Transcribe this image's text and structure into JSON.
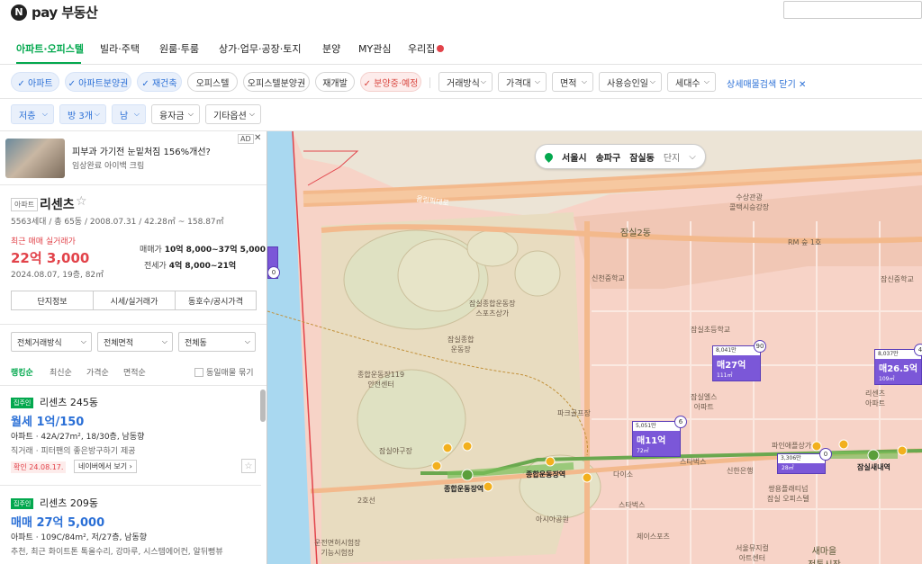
{
  "brand": {
    "logo_letter": "N",
    "name": "pay 부동산"
  },
  "nav": {
    "items": [
      {
        "label": "아파트·오피스텔",
        "active": true
      },
      {
        "label": "빌라·주택"
      },
      {
        "label": "원룸·투룸"
      },
      {
        "label": "상가·업무·공장·토지"
      },
      {
        "label": "분양"
      },
      {
        "label": "MY관심"
      },
      {
        "label": "우리집"
      }
    ]
  },
  "filters": {
    "chips": [
      {
        "label": "✓ 아파트",
        "style": "sel"
      },
      {
        "label": "✓ 아파트분양권",
        "style": "sel"
      },
      {
        "label": "✓ 재건축",
        "style": "sel"
      },
      {
        "label": "오피스텔",
        "style": "plain"
      },
      {
        "label": "오피스텔분양권",
        "style": "plain"
      },
      {
        "label": "재개발",
        "style": "plain"
      },
      {
        "label": "✓ 분양중·예정",
        "style": "red"
      }
    ],
    "dropdowns": [
      "거래방식",
      "가격대",
      "면적",
      "사용승인일",
      "세대수"
    ],
    "detail_close": "상세매물검색 닫기 ✕",
    "row2": [
      {
        "label": "저층",
        "style": "blue"
      },
      {
        "label": "방 3개",
        "style": "blue"
      },
      {
        "label": "남",
        "style": "blue"
      },
      {
        "label": "융자금",
        "style": "gray"
      },
      {
        "label": "기타옵션",
        "style": "gray"
      }
    ]
  },
  "ad": {
    "title": "피부과 가기전 눈밑처짐 156%개선?",
    "sub": "임상완료 아이백 크림",
    "badge": "AD",
    "close": "✕"
  },
  "complex": {
    "tag": "아파트",
    "name": "리센츠",
    "star": "☆",
    "info": "5563세대 / 총 65동 / 2008.07.31 / 42.28㎡ ~ 158.87㎡",
    "recent_label": "최근 매매 실거래가",
    "recent_price": "22억 3,000",
    "recent_date": "2024.08.07, 19층, 82㎡",
    "sale_label": "매매가",
    "sale_value": "10억 8,000~37억 5,000",
    "jeonse_label": "전세가",
    "jeonse_value": "4억 8,000~21억",
    "buttons": [
      "단지정보",
      "시세/실거래가",
      "동호수/공시가격"
    ]
  },
  "list_filters": [
    "전체거래방식",
    "전체면적",
    "전체동"
  ],
  "sorts": [
    "랭킹순",
    "최신순",
    "가격순",
    "면적순"
  ],
  "same_listing": "동일매물 묶기",
  "listings": [
    {
      "badge": "집주인",
      "title": "리센츠 245동",
      "price": "월세 1억/150",
      "spec": "아파트 · 42A/27m², 18/30층, 남동향",
      "desc": "직거래 · 피터팬의 좋은방구하기 제공",
      "confirm": "확인 24.08.17.",
      "source": "네이버에서 보기 ›",
      "star": "☆"
    },
    {
      "badge": "집주인",
      "title": "리센츠 209동",
      "price": "매매 27억 5,000",
      "spec": "아파트 · 109C/84m², 저/27층, 남동향",
      "desc": "추천, 최근 화이트톤 톡올수리, 강마루, 시스템에어컨, 알뒤뻥뷰",
      "confirm": "",
      "source": "",
      "star": ""
    }
  ],
  "map": {
    "location": {
      "city": "서울시",
      "district": "송파구",
      "dong": "잠실동",
      "level": "단지"
    },
    "labels": {
      "olympic_road": "올림픽대로",
      "jamsil2": "잠실2동",
      "suyoung": "수상관광\n콜택시승강장",
      "rm": "RM 숲 1호",
      "sports": "잠실종합운동장\n스포츠상가",
      "sincheon_mid": "신천중학교",
      "jamsil_sports": "잠실종합\n운동장",
      "elem": "잠실초등학교",
      "jamsil_mid": "잠신중학교",
      "police": "종합운동장119\n안전센터",
      "parking": "파크골프장",
      "baseball": "잠실야구장",
      "daiso": "다이소",
      "starbucks": "스타벅스",
      "shinhan": "신한은행",
      "asia_park": "아시아공원",
      "jeios": "제이스포츠",
      "starbucks2": "스타벅스",
      "seoul_music": "서울뮤지컬\n아트센터",
      "saemaeul": "새마을\n전통시장",
      "inspect": "운전면허시험장\n기능시험장",
      "elsa": "잠실엘스\n아파트",
      "ricenz": "리센츠\n아파트",
      "fine": "파인애플상가",
      "nine": "쌍용플래티넘\n잠실 오피스텔",
      "st1": "종합운동장역",
      "st2": "종합운동장역",
      "st3": "잠실새내역",
      "road2": "2호선"
    },
    "markers": [
      {
        "top": "8,041만",
        "main": "매27억",
        "sub": "111㎡",
        "count": "90"
      },
      {
        "top": "8,037만",
        "main": "매26.5억",
        "sub": "109㎡",
        "count": "4"
      },
      {
        "top": "5,051만",
        "main": "매11억",
        "sub": "72㎡",
        "count": "6"
      },
      {
        "top": "3,306만",
        "main": "",
        "sub": "28㎡",
        "count": "0"
      },
      {
        "top": "",
        "main": "",
        "sub": "",
        "count": "0"
      }
    ],
    "colors": {
      "residential": "#f7d3c7",
      "park": "#e8dcc0",
      "road": "#f3b98c",
      "river": "#a9d8f0",
      "subway": "#6aa84f"
    }
  }
}
